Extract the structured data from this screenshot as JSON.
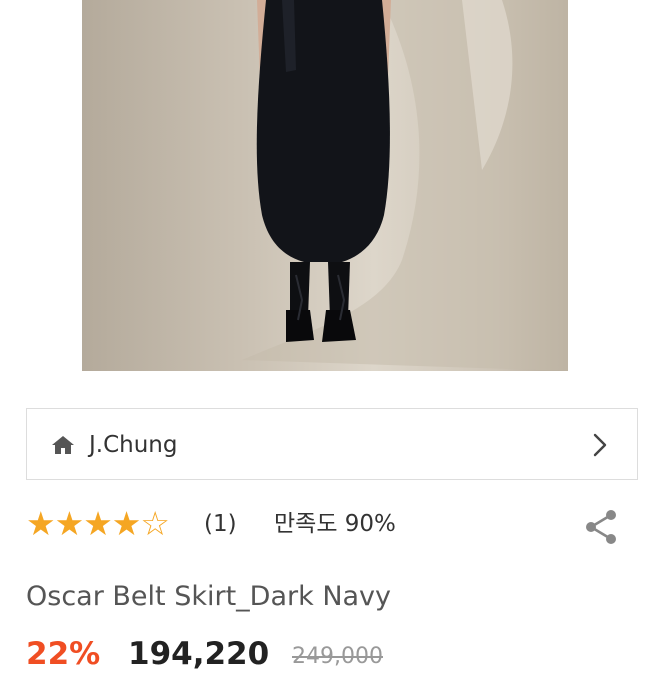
{
  "product_image": {
    "alt": ""
  },
  "store": {
    "name": "J.Chung",
    "home_icon": "home-icon",
    "chevron_icon": "chevron-right-icon"
  },
  "rating": {
    "stars_filled": 4,
    "stars_total": 5,
    "review_count": "(1)",
    "satisfaction": "만족도 90%",
    "star_color": "#f5a623"
  },
  "share": {
    "icon": "share-icon"
  },
  "product": {
    "title": "Oscar Belt Skirt_Dark Navy"
  },
  "pricing": {
    "discount": "22%",
    "price": "194,220",
    "original_price": "249,000",
    "discount_color": "#f04e23"
  }
}
